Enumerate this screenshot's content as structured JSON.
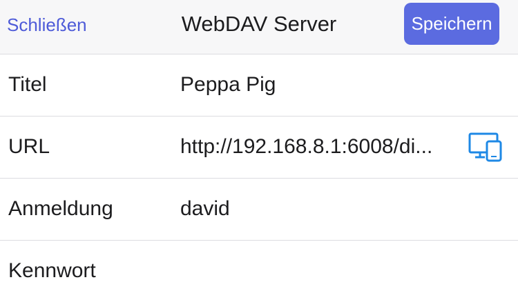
{
  "nav": {
    "close_label": "Schließen",
    "title": "WebDAV Server",
    "save_label": "Speichern"
  },
  "form": {
    "rows": [
      {
        "label": "Titel",
        "value": "Peppa Pig"
      },
      {
        "label": "URL",
        "value": "http://192.168.8.1:6008/di..."
      },
      {
        "label": "Anmeldung",
        "value": "david"
      },
      {
        "label": "Kennwort",
        "value": ""
      }
    ],
    "url_icon": "devices-icon"
  },
  "colors": {
    "accent": "#4e5bd8",
    "save_button_bg": "#5b6be0",
    "icon_blue": "#1e88e5",
    "nav_bg": "#f7f7f8",
    "separator": "#dcdce0"
  }
}
